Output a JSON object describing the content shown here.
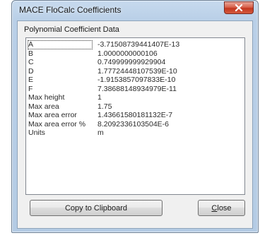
{
  "window": {
    "title": "MACE FloCalc Coefficients"
  },
  "group": {
    "label": "Polynomial Coefficient Data"
  },
  "rows": [
    {
      "name": "A",
      "value": "-3.71508739441407E-13",
      "selected": true
    },
    {
      "name": "B",
      "value": "1.0000000000106"
    },
    {
      "name": "C",
      "value": "0.749999999929904"
    },
    {
      "name": "D",
      "value": "1.77724448107539E-10"
    },
    {
      "name": "E",
      "value": "-1.9153857097833E-10"
    },
    {
      "name": "F",
      "value": "7.38688148934979E-11"
    },
    {
      "name": "Max height",
      "value": "1"
    },
    {
      "name": "Max area",
      "value": "1.75"
    },
    {
      "name": "Max area error",
      "value": "1.43661580181132E-7"
    },
    {
      "name": "Max area error %",
      "value": "8.2092336103504E-6"
    },
    {
      "name": "Units",
      "value": "m"
    }
  ],
  "buttons": {
    "copy_label": "Copy to Clipboard",
    "close_label_first": "C",
    "close_label_rest": "lose"
  },
  "colors": {
    "titlebar": "#c7daee",
    "close_button": "#d8634d",
    "dialog_face": "#f0f0f0"
  },
  "icons": {
    "close": "close-x-icon"
  }
}
